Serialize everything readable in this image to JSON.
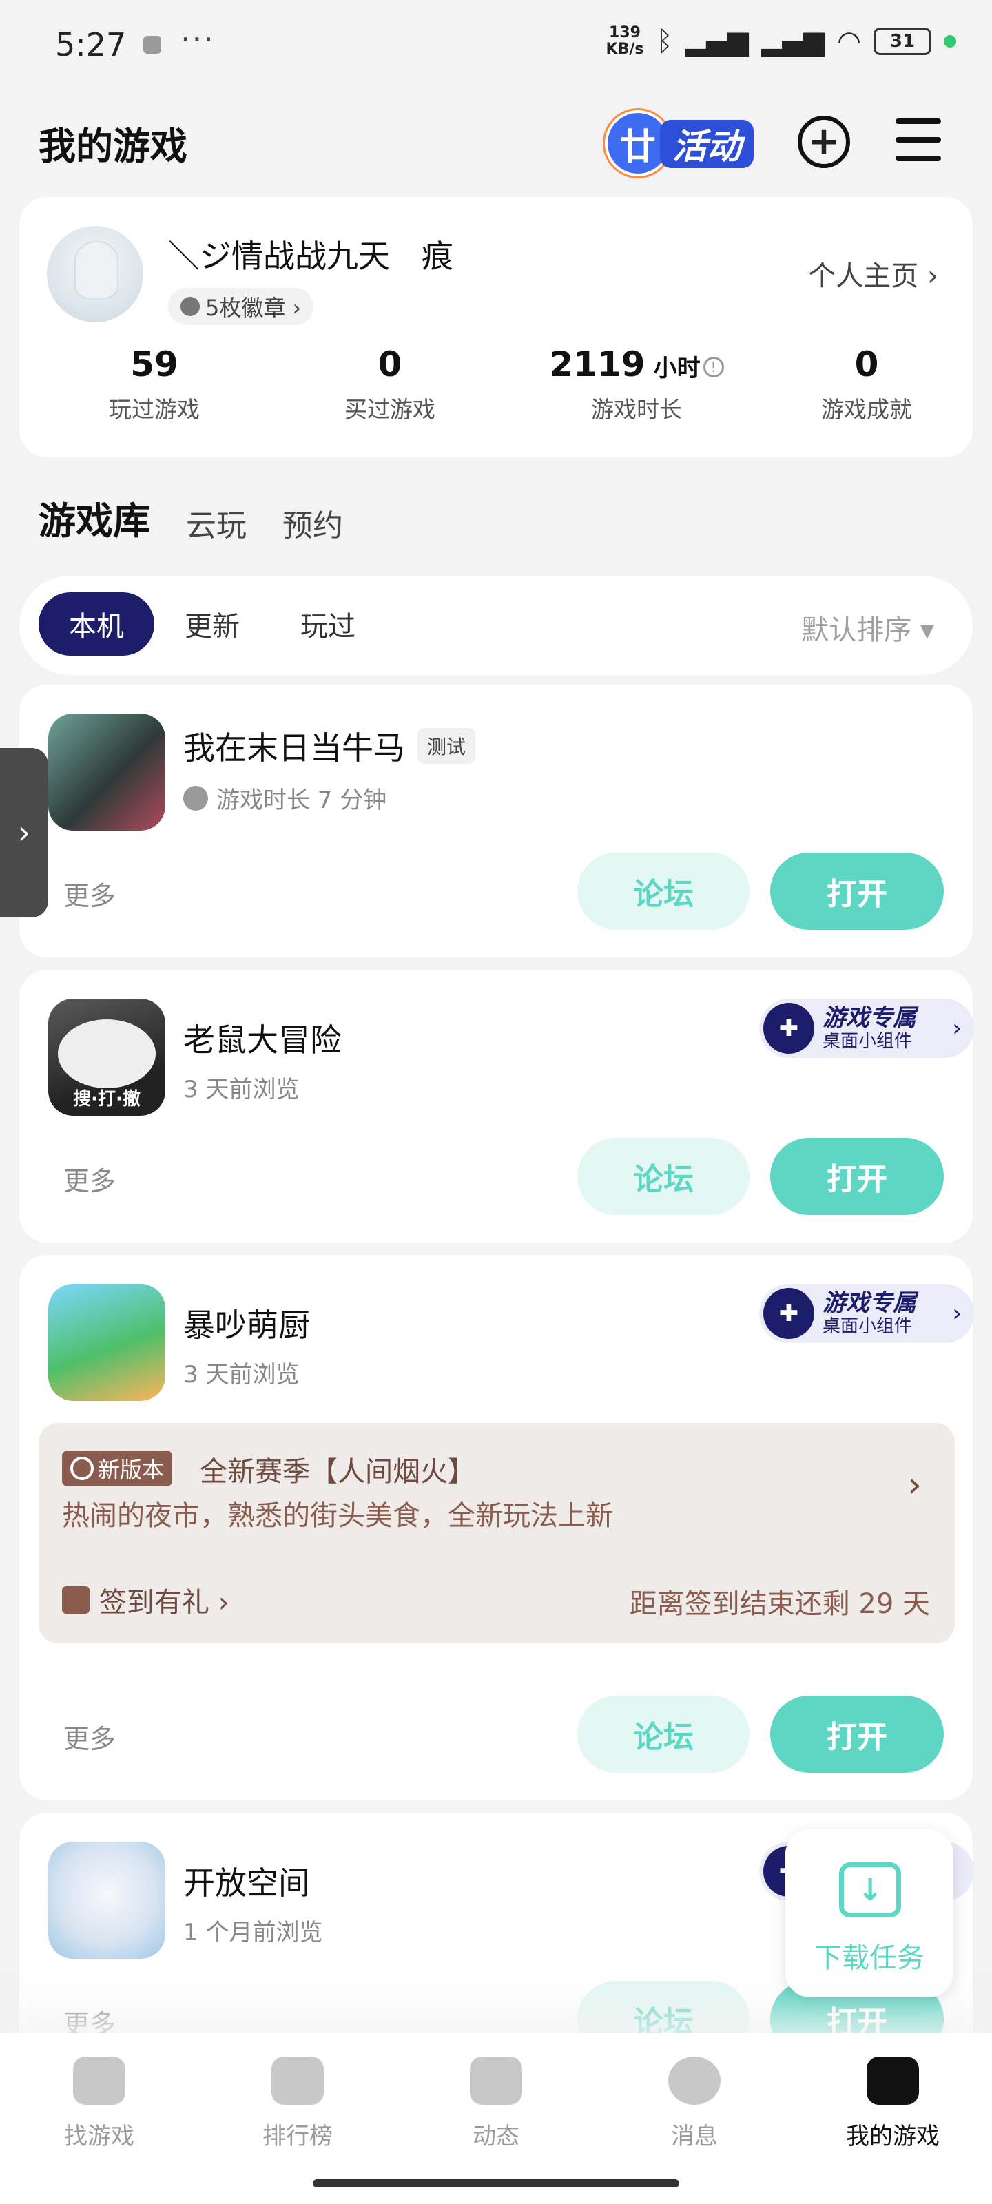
{
  "status": {
    "time": "5:27",
    "speed": "139\nKB/s",
    "battery": "31"
  },
  "header": {
    "title": "我的游戏",
    "activity_label": "活动"
  },
  "profile": {
    "username": "＼ジ情战战九天　痕",
    "badges": "5枚徽章 ›",
    "homepage": "个人主页 ›",
    "stats": [
      {
        "value": "59",
        "unit": "",
        "label": "玩过游戏"
      },
      {
        "value": "0",
        "unit": "",
        "label": "买过游戏"
      },
      {
        "value": "2119",
        "unit": "小时",
        "label": "游戏时长"
      },
      {
        "value": "0",
        "unit": "",
        "label": "游戏成就"
      }
    ]
  },
  "tabs": [
    "游戏库",
    "云玩",
    "预约"
  ],
  "filters": [
    "本机",
    "更新",
    "玩过"
  ],
  "sort_label": "默认排序 ▾",
  "common": {
    "more": "更多",
    "forum": "论坛",
    "open": "打开",
    "widget_title": "游戏专属",
    "widget_sub": "桌面小组件"
  },
  "games": [
    {
      "name": "我在末日当牛马",
      "tag": "测试",
      "sub": "游戏时长 7 分钟"
    },
    {
      "name": "老鼠大冒险",
      "sub": "3 天前浏览",
      "icon_text": "搜·打·撤"
    },
    {
      "name": "暴吵萌厨",
      "sub": "3 天前浏览"
    },
    {
      "name": "开放空间",
      "sub": "1 个月前浏览"
    }
  ],
  "event": {
    "tag": "新版本",
    "title": "全新赛季【人间烟火】",
    "desc": "热闹的夜市，熟悉的街头美食，全新玩法上新",
    "sign": "签到有礼 ›",
    "remain": "距离签到结束还剩 29 天"
  },
  "download_task": "下载任务",
  "nav": [
    "找游戏",
    "排行榜",
    "动态",
    "消息",
    "我的游戏"
  ],
  "colors": {
    "accent": "#5dd6c4",
    "navy": "#1d1e6b",
    "event_brown": "#8a5c4f"
  }
}
